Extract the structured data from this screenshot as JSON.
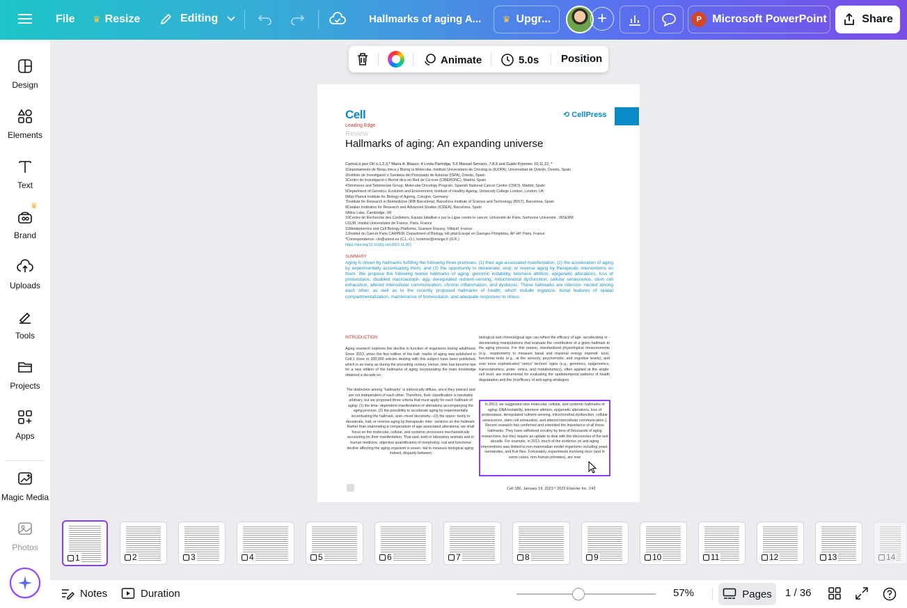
{
  "topbar": {
    "file_label": "File",
    "resize_label": "Resize",
    "editing_label": "Editing",
    "doc_title": "Hallmarks of aging A...",
    "upgrade_label": "Upgr...",
    "app_label": "Microsoft PowerPoint",
    "share_label": "Share"
  },
  "context_toolbar": {
    "animate_label": "Animate",
    "duration_label": "5.0s",
    "position_label": "Position"
  },
  "sidebar": {
    "items": [
      {
        "label": "Design",
        "icon": "design-icon"
      },
      {
        "label": "Elements",
        "icon": "elements-icon"
      },
      {
        "label": "Text",
        "icon": "text-icon"
      },
      {
        "label": "Brand",
        "icon": "brand-icon"
      },
      {
        "label": "Uploads",
        "icon": "uploads-icon"
      },
      {
        "label": "Tools",
        "icon": "tools-icon"
      },
      {
        "label": "Projects",
        "icon": "projects-icon"
      },
      {
        "label": "Apps",
        "icon": "apps-icon"
      },
      {
        "label": "Magic Media",
        "icon": "magic-media-icon"
      },
      {
        "label": "Photos",
        "icon": "photos-icon"
      }
    ]
  },
  "document": {
    "journal": "Cell",
    "section": "Leading Edge",
    "type": "Review",
    "title": "Hallmarks of aging: An expanding universe",
    "publisher": "CellPress",
    "authors": "CarlosLó pez-Otí n,1,2,3,* María A. Blasco,   4 Linda Partridge,   5,6 Manuel Serrano,   7,8,9 and Guido Kroemer   10,11,12, *",
    "affiliations": [
      "1Departamento de Bioqu ímica y Biolog ía Molecular, Instituto Universitario de Oncolog ía (IUOPA), Universidad de Oviedo, Oviedo, Spain",
      "2Instituto de Investigació n Sanitaria del Principado de Asturias (ISPA), Oviedo, Spain",
      "3Centro de Investigació n Biomé dica en Red de Cá ncer (CIBERONC), Madrid, Spain",
      "4Telomeres and Telomerase Group, Molecular Oncology Program, Spanish National Cancer Centre (CNIO), Madrid, Spain",
      "5Department of Genetics, Evolution and Environment, Institute of Healthy Ageing, University College London, London, UK",
      "6Max Planck Institute for Biology of Ageing, Cologne, Germany",
      "7Institute for Research in Biomedicine (IRB Barcelona), Barcelona Institute of Science and Technology (BIST), Barcelona, Spain",
      "8Catalan Institution for Research and Advanced Studies (ICREA), Barcelona, Spain",
      "9Altos Labs, Cambridge, UK",
      "10Centre de Recherche des Cordeliers, Equipe labellisé e par la Ligue contre le cancer, Université  de Paris, Sorbonne Université , INSERM",
      "U1138, Institut Universitaire de France, Paris, France",
      "11Metabolomics and Cell Biology Platforms, Gustave Roussy, Villejuif, France",
      "12Institut du Cancer Paris CARPEM, Department of Biology, Hô pital Europé en Georges Pompidou, AP-HP, Paris, France",
      "*Correspondence: clo@uniovi.es (C.L.-O.), kroemer@orange.fr (G.K.)",
      "https://doi.org/10.1016/j.cell.2022.11.001"
    ],
    "summary_heading": "SUMMARY",
    "summary": "Aging is driven by hallmarks fulfilling the following three premises: (1) their age-associated manifestation, (2) the acceleration of aging by experimentally accentuating them, and (3) the opportunity to decelerate, stop, or reverse aging by therapeutic interventions on them. We propose the following twelve hallmarks of aging: genomic instability, telomere attrition, epigenetic alterations, loss of proteostasis, disabled macroautoph- agy, deregulated nutrient-sensing, mitochondrial dysfunction, cellular senescence, stem cell exhaustion, altered intercellular communication, chronic inflammation, and dysbiosis. These hallmarks are intercon- nected among each other, as well as to the recently proposed hallmarks of health, which include organiza- tional features of spatial compartmentalization, maintenance of homeostasis, and adequate responses to stress.",
    "intro_heading": "INTRODUCTION",
    "intro_p1": "Aging research explores the decline in function of organisms during adulthood. Since 2013, when the first edition of the hall- marks of aging was published in Cell,1 close to 300,000 articles dealing with this subject have been published, which is as many as during the preceding century. Hence, time has become ripe for a new edition of the hallmarks of aging incorporating the main knowledge obtained a decade on.",
    "intro_p2": "The distinction among “hallmarks” is intrinsically diffuse, since they interact and are not independent of each other. Therefore, their classification is inevitably arbitrary, but we proposed three criteria that must apply for each hallmark of aging: (1) the time- dependent manifestation of alterations accompanying the aging process, (2) the possibility to accelerate aging by experimentally accentuating the hallmark, and—most decisively—(3) the oppor- tunity to decelerate, halt, or reverse aging by therapeutic inter- ventions on the hallmark. Rather than elaborating a compendium of age-associated alterations, we shall focus on the molecular, cellular, and systemic processes mechanistically accounting for their manifestation. That said, both in laboratory animals and in human medicine, objective quantification of morpholog- ical and functional decline affecting the aging organism is essen- tial to measure biological aging. Indeed, disparity between",
    "right_p1": "biological and chronological age can reflect the efficacy of age- accelerating or -decelerating manipulations that evaluate the contribution of a given hallmark to the aging process. For this reason, standardized physiological measurements (e.g., respirometry to measure basal and maximal energy expendi- ture), functional tests (e.g., at the sensory, psychomotor, and cognitive levels), and ever more sophisticated “omics” technol- ogies (e.g., genomics, epigenomics, transcriptomics, prote- omics, and metabolomics), often applied at the single-cell level, are instrumental for evaluating the spatiotemporal patterns of health degradation and the (in)efficacy of anti-aging strategies.",
    "right_p2": "In 2013, we suggested nine molecular, cellular, and systemic hallmarks of aging: DNA instability, telomere attrition, epigenetic alterations, loss of proteostasis, deregulated nutrient-sensing, mitochondrial dysfunction, cellular senescence, stem cell exhaustion, and altered intercellular communication.1 Recent research has confirmed and extended the importance of all these hallmarks. They have withstood scrutiny by tens of thousands of aging researchers, but they require an update to deal with the discoveries of the last decade. For example, in 2013, much of the evidence on anti-aging interventions was limited to non-mammalian model organisms including yeast, nematodes, and fruit flies. Fortunately, experiments involving mice (and in some cases, non-human primates), are now",
    "footer_cite": "Cell 186, January 19, 2023 ª 2022 Elsevier Inc.   243"
  },
  "thumbnails": [
    "1",
    "2",
    "3",
    "4",
    "5",
    "6",
    "7",
    "8",
    "9",
    "10",
    "11",
    "12",
    "13",
    "14"
  ],
  "footer": {
    "notes_label": "Notes",
    "duration_label": "Duration",
    "zoom": "57%",
    "pages_label": "Pages",
    "page_counter": "1 / 36"
  }
}
